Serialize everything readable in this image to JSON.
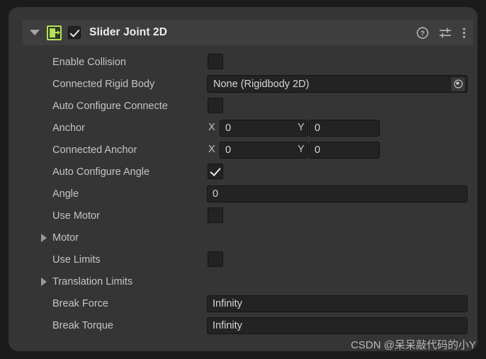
{
  "component": {
    "title": "Slider Joint 2D",
    "enabled": true,
    "expanded": true,
    "icon": "slider-joint-2d-icon",
    "accent_color": "#b4e05a",
    "header_icons": [
      {
        "name": "help-icon",
        "glyph": "?"
      },
      {
        "name": "preset-icon",
        "glyph": "sliders"
      },
      {
        "name": "more-menu-icon",
        "glyph": "kebab"
      }
    ]
  },
  "properties": {
    "enable_collision": {
      "label": "Enable Collision",
      "checked": false
    },
    "connected_rigid_body": {
      "label": "Connected Rigid Body",
      "value": "None (Rigidbody 2D)"
    },
    "auto_configure_connected_anchor": {
      "label": "Auto Configure Connecte",
      "checked": false
    },
    "anchor": {
      "label": "Anchor",
      "x_label": "X",
      "x": "0",
      "y_label": "Y",
      "y": "0"
    },
    "connected_anchor": {
      "label": "Connected Anchor",
      "x_label": "X",
      "x": "0",
      "y_label": "Y",
      "y": "0"
    },
    "auto_configure_angle": {
      "label": "Auto Configure Angle",
      "checked": true
    },
    "angle": {
      "label": "Angle",
      "value": "0"
    },
    "use_motor": {
      "label": "Use Motor",
      "checked": false
    },
    "motor": {
      "label": "Motor",
      "expanded": false
    },
    "use_limits": {
      "label": "Use Limits",
      "checked": false
    },
    "translation_limits": {
      "label": "Translation Limits",
      "expanded": false
    },
    "break_force": {
      "label": "Break Force",
      "value": "Infinity"
    },
    "break_torque": {
      "label": "Break Torque",
      "value": "Infinity"
    }
  },
  "watermark": {
    "text": "CSDN @呆呆敲代码的小Y"
  }
}
